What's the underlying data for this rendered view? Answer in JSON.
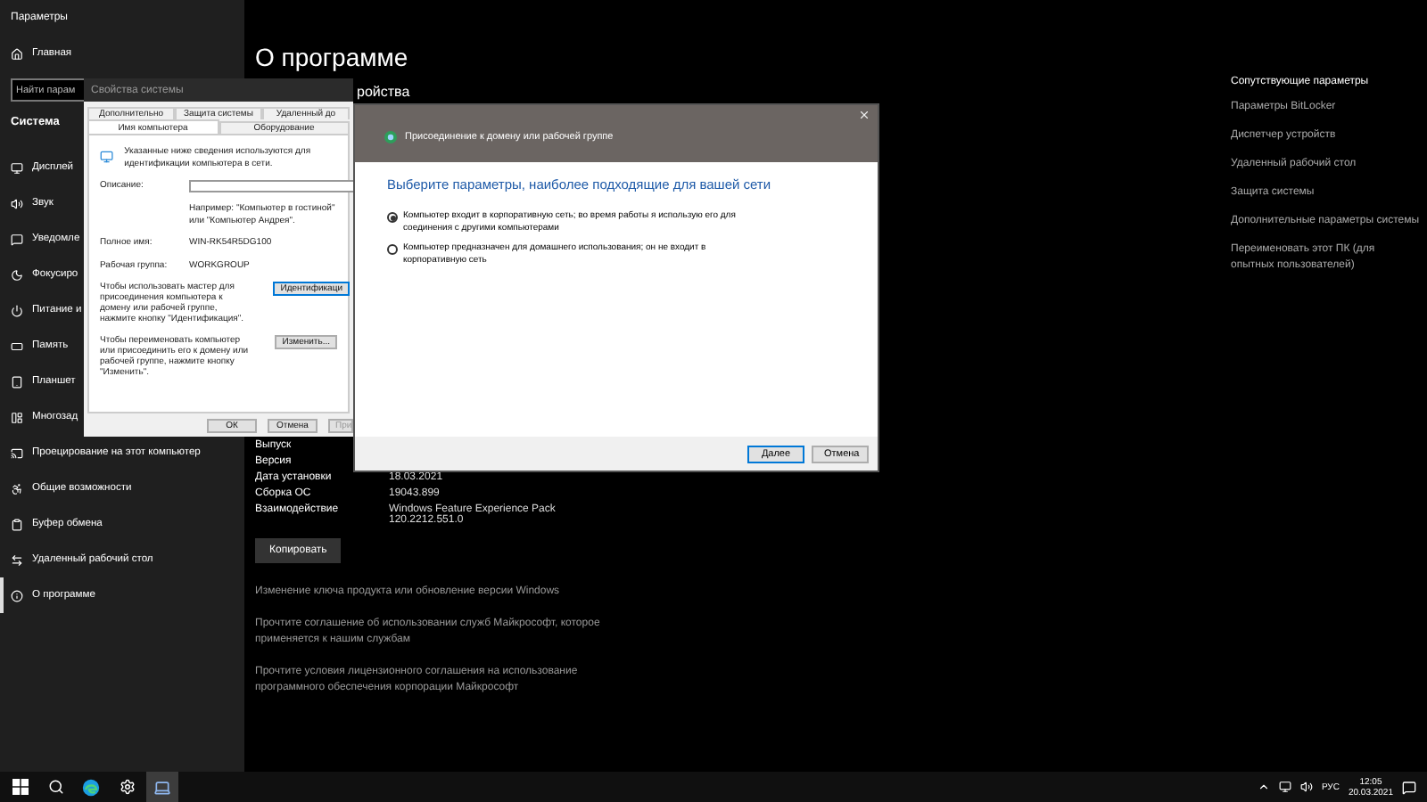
{
  "window": {
    "title": "Параметры"
  },
  "sidebar": {
    "home": "Главная",
    "search": {
      "placeholder": "Найти парам"
    },
    "section": "Система",
    "items": [
      {
        "label": "Дисплей",
        "selected": false
      },
      {
        "label": "Звук",
        "selected": false
      },
      {
        "label": "Уведомле",
        "selected": false
      },
      {
        "label": "Фокусиро",
        "selected": false
      },
      {
        "label": "Питание и",
        "selected": false
      },
      {
        "label": "Память",
        "selected": false
      },
      {
        "label": "Планшет",
        "selected": false
      },
      {
        "label": "Многозад",
        "selected": false
      },
      {
        "label": "Проецирование на этот компьютер",
        "selected": false
      },
      {
        "label": "Общие возможности",
        "selected": false
      },
      {
        "label": "Буфер обмена",
        "selected": false
      },
      {
        "label": "Удаленный рабочий стол",
        "selected": false
      },
      {
        "label": "О программе",
        "selected": true
      }
    ]
  },
  "main": {
    "title": "О программе",
    "subtitle": "ройства",
    "specs": [
      {
        "label": "Выпуск"
      },
      {
        "label": "Версия"
      },
      {
        "label": "Дата установки",
        "value": "18.03.2021"
      },
      {
        "label": "Сборка ОС",
        "value": "19043.899"
      },
      {
        "label": "Взаимодействие",
        "value": "Windows Feature Experience Pack 120.2212.551.0"
      }
    ],
    "copy_button": "Копировать",
    "links": [
      "Изменение ключа продукта или обновление версии Windows",
      "Прочтите соглашение об использовании служб Майкрософт, которое применяется к нашим службам",
      "Прочтите условия лицензионного соглашения на использование программного обеспечения корпорации Майкрософт"
    ]
  },
  "related": {
    "title": "Сопутствующие параметры",
    "links": [
      "Параметры BitLocker",
      "Диспетчер устройств",
      "Удаленный рабочий стол",
      "Защита системы",
      "Дополнительные параметры системы",
      "Переименовать этот ПК (для опытных пользователей)"
    ]
  },
  "system_properties": {
    "title": "Свойства системы",
    "tabs_row_1": [
      {
        "label": "Дополнительно",
        "selected": false
      },
      {
        "label": "Защита системы",
        "selected": false
      },
      {
        "label": "Удаленный до",
        "selected": false
      }
    ],
    "tabs_row_2": [
      {
        "label": "Имя компьютера",
        "selected": true
      },
      {
        "label": "Оборудование",
        "selected": false
      }
    ],
    "intro": "Указанные ниже сведения используются для идентификации компьютера в сети.",
    "description": {
      "label": "Описание:",
      "hint": "Например: \"Компьютер в гостиной\" или \"Компьютер Андрея\"."
    },
    "fields": [
      {
        "label": "Полное имя:",
        "value": "WIN-RK54R5DG100"
      },
      {
        "label": "Рабочая группа:",
        "value": "WORKGROUP"
      }
    ],
    "actions": [
      {
        "text": "Чтобы использовать мастер для присоединения компьютера к домену или рабочей группе, нажмите кнопку \"Идентификация\".",
        "button": "Идентификаци",
        "focused": true
      },
      {
        "text": "Чтобы переименовать компьютер или присоединить его к домену или рабочей группе, нажмите кнопку \"Изменить\".",
        "button": "Изменить...",
        "focused": false
      }
    ],
    "buttons": [
      {
        "label": "ОК",
        "disabled": false
      },
      {
        "label": "Отмена",
        "disabled": false
      },
      {
        "label": "При",
        "disabled": true
      }
    ]
  },
  "join_dialog": {
    "title": "Присоединение к домену или рабочей группе",
    "heading": "Выберите параметры, наиболее подходящие для вашей сети",
    "options": [
      {
        "label": "Компьютер входит в корпоративную сеть; во время работы я использую его для соединения с другими компьютерами",
        "selected": true
      },
      {
        "label": "Компьютер предназначен для домашнего использования; он не входит в корпоративную сеть",
        "selected": false
      }
    ],
    "buttons": [
      {
        "label": "Далее",
        "focused": true
      },
      {
        "label": "Отмена",
        "focused": false
      }
    ]
  },
  "taskbar": {
    "apps": [
      {
        "active": false
      },
      {
        "active": false
      },
      {
        "active": false
      },
      {
        "active": false
      },
      {
        "active": true
      }
    ],
    "language": "РУС",
    "time": "12:05",
    "date": "20.03.2021"
  }
}
